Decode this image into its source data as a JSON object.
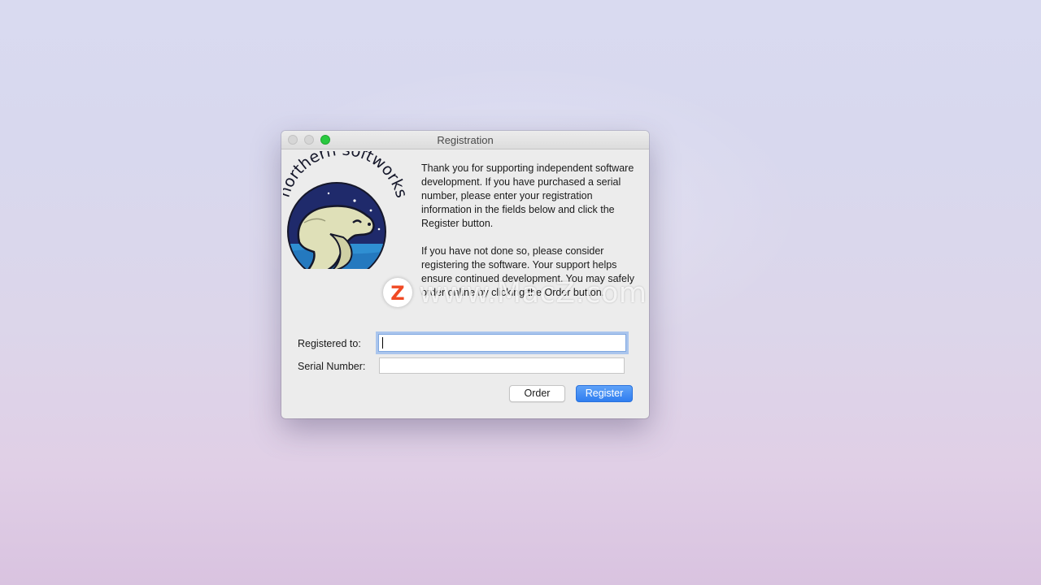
{
  "window": {
    "title": "Registration"
  },
  "logo": {
    "brand_text": "northern softworks"
  },
  "message": {
    "paragraph_1": "Thank you for supporting independent software development.  If you have purchased a serial number, please enter your registration information in the fields below and click the Register button.",
    "paragraph_2": "If you have not done so, please consider registering the software.  Your support helps ensure continued development.  You may safely order online by clicking the Order button."
  },
  "form": {
    "registered_to_label": "Registered to:",
    "registered_to_value": "",
    "serial_number_label": "Serial Number:",
    "serial_number_value": ""
  },
  "buttons": {
    "order_label": "Order",
    "register_label": "Register"
  },
  "watermark": {
    "badge_letter": "Z",
    "text": "www.MacZ.com"
  },
  "colors": {
    "accent": "#2f7ef0",
    "zoom_button": "#29c940",
    "focus_ring": "#5a96f0",
    "watermark_badge": "#f04a24",
    "logo_navy": "#1f2a6b",
    "logo_water": "#2f8fd2"
  },
  "icons": {
    "close": "close-button-icon",
    "minimize": "minimize-button-icon",
    "zoom": "zoom-button-icon",
    "logo": "polar-bear-logo-icon"
  }
}
